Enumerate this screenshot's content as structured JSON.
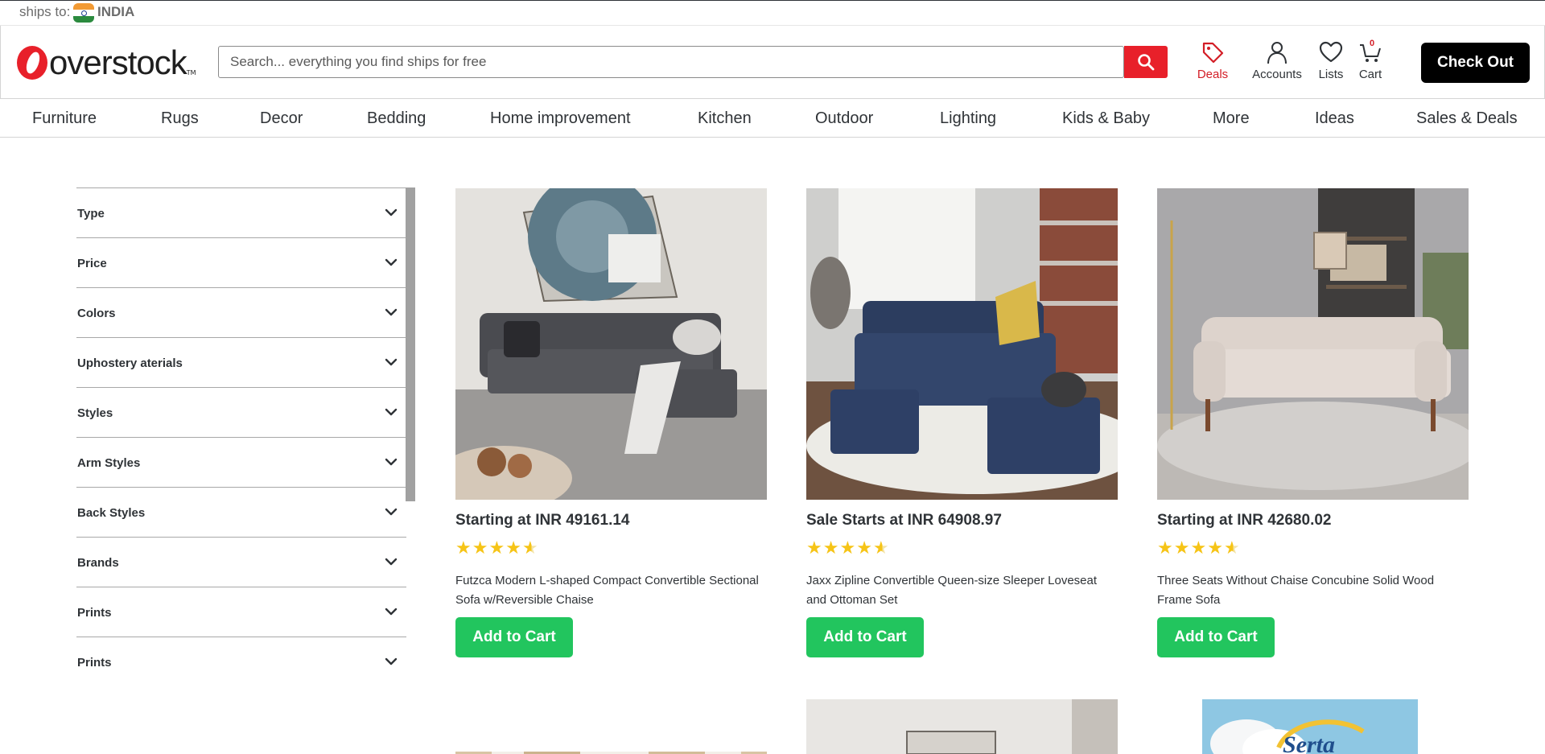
{
  "ships_to": {
    "label": "ships to:",
    "country": "INDIA"
  },
  "header": {
    "logo_text": "overstock",
    "logo_tm": "TM",
    "search_placeholder": "Search... everything you find ships for free",
    "links": {
      "deals": "Deals",
      "accounts": "Accounts",
      "lists": "Lists",
      "cart": "Cart"
    },
    "cart_count": "0",
    "checkout": "Check Out"
  },
  "nav": [
    "Furniture",
    "Rugs",
    "Decor",
    "Bedding",
    "Home improvement",
    "Kitchen",
    "Outdoor",
    "Lighting",
    "Kids & Baby",
    "More",
    "Ideas",
    "Sales & Deals"
  ],
  "filters": [
    "Type",
    "Price",
    "Colors",
    "Uphostery aterials",
    "Styles",
    "Arm Styles",
    "Back Styles",
    "Brands",
    "Prints",
    "Prints"
  ],
  "products": [
    {
      "price": "Starting at INR 49161.14",
      "rating": 4.5,
      "name": "Futzca Modern L-shaped Compact Convertible Sectional Sofa w/Reversible Chaise",
      "cta": "Add to Cart"
    },
    {
      "price": "Sale Starts at INR 64908.97",
      "rating": 4.5,
      "name": "Jaxx Zipline Convertible Queen-size Sleeper Loveseat and Ottoman Set",
      "cta": "Add to Cart"
    },
    {
      "price": "Starting at INR 42680.02",
      "rating": 4.5,
      "name": "Three Seats Without Chaise Concubine Solid Wood Frame Sofa",
      "cta": "Add to Cart"
    }
  ],
  "partial_logo_text": "Serta",
  "colors": {
    "brand_red": "#e8202a",
    "deals_red": "#d31d26",
    "cta_green": "#22c55e",
    "star_yellow": "#f6c417",
    "checkout_black": "#000000"
  },
  "icons": [
    "flag-india-icon",
    "search-icon",
    "tag-icon",
    "user-icon",
    "heart-icon",
    "cart-icon",
    "chevron-down-icon",
    "star-icon"
  ]
}
